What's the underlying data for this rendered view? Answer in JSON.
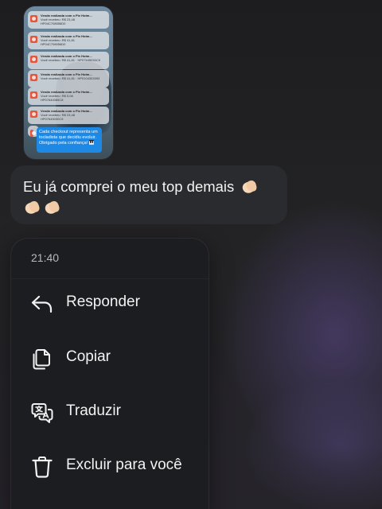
{
  "thumbnail": {
    "notifications": [
      {
        "title": "Venda realizada com o Pix Hotm...",
        "line2": "Você recebeu: R$ 23,48",
        "line3": "HP04C708056D0"
      },
      {
        "title": "Venda realizada com o Pix Hotm...",
        "line2": "Você recebeu: R$ 41,81",
        "line3": "HP04C708056D0"
      },
      {
        "title": "Venda realizada com o Pix Hotm...",
        "line2": "Você recebeu: R$ 41,81 · HP07645030C5",
        "line3": ""
      },
      {
        "title": "Venda realizada com o Pix Hotm...",
        "line2": "Você recebeu: R$ 41,81 · HP0104303393",
        "line3": ""
      },
      {
        "title": "Venda realizada com o Pix Hotm...",
        "line2": "Você recebeu: R$ 5,08",
        "line3": "HP07640085C8"
      },
      {
        "title": "Venda realizada com o Pix Hotm...",
        "line2": "Você recebeu: R$ 23,48",
        "line3": "HP07645030C5"
      },
      {
        "title": "Venda realizada com o Pix Hotm...",
        "line2": "",
        "line3": ""
      }
    ],
    "caption": "Cada checkout representa um tocladista que decidiu evoluir. Obrigado pela confiança! 🎹"
  },
  "message": {
    "text": "Eu já comprei o meu top demais"
  },
  "menu": {
    "time": "21:40",
    "items": [
      {
        "label": "Responder",
        "icon": "reply-icon"
      },
      {
        "label": "Copiar",
        "icon": "copy-icon"
      },
      {
        "label": "Traduzir",
        "icon": "translate-icon"
      },
      {
        "label": "Excluir para você",
        "icon": "trash-icon"
      }
    ]
  }
}
